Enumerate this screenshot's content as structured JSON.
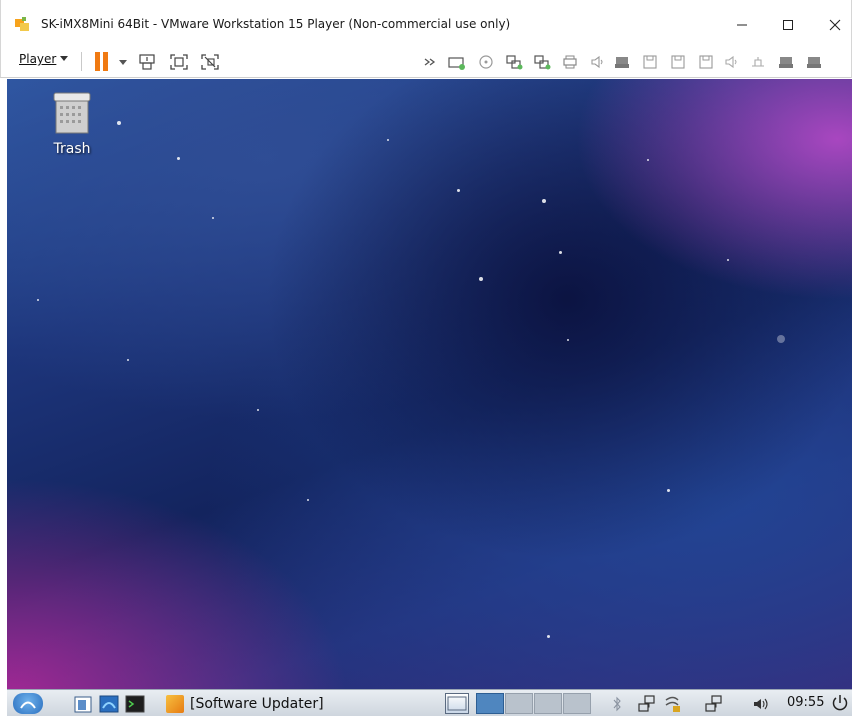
{
  "window": {
    "title": "SK-iMX8Mini 64Bit - VMware Workstation 15 Player (Non-commercial use only)",
    "app_icon": "vmware-player-icon",
    "controls": [
      "minimize-icon",
      "maximize-icon",
      "close-icon"
    ]
  },
  "toolbar": {
    "player_menu_label": "Player",
    "accent_color": "#f07a12",
    "icons": [
      "pause-icon",
      "dropdown-arrow-icon",
      "send-ctrl-alt-del-icon",
      "fit-guest-icon",
      "unity-icon",
      "more-icon"
    ],
    "device_icons": [
      "hard-disk-icon",
      "cd-dvd-icon",
      "network-adapter-icon",
      "network-adapter-icon",
      "printer-icon",
      "sound-icon",
      "usb-device-icon",
      "floppy-icon",
      "floppy-icon",
      "floppy-icon",
      "sound-icon",
      "bluetooth-icon",
      "usb-device-icon",
      "usb-device-icon"
    ]
  },
  "desktop": {
    "trash_label": "Trash"
  },
  "taskbar": {
    "task_label": "[Software Updater]",
    "clock": "09:55",
    "tray_icons": [
      "bluetooth-icon",
      "network-icon",
      "updates-icon",
      "network-icon",
      "volume-icon"
    ],
    "launchers": [
      "file-manager-icon",
      "browser-icon",
      "terminal-icon"
    ]
  }
}
